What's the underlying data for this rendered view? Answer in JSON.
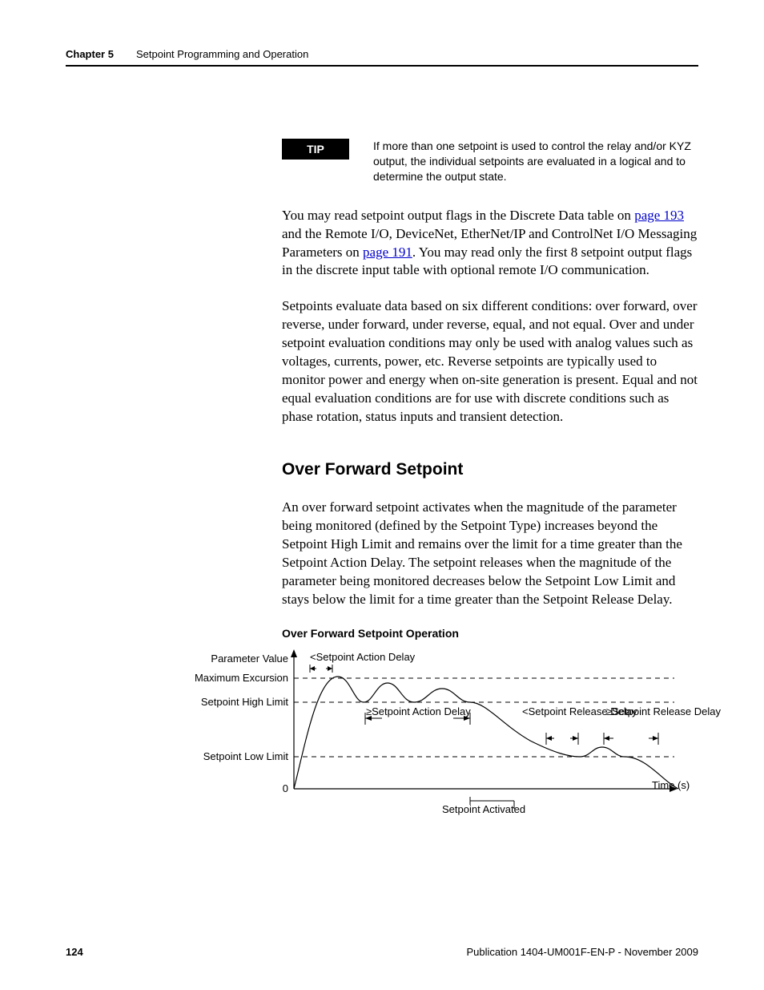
{
  "header": {
    "chapter_label": "Chapter 5",
    "chapter_title": "Setpoint Programming and Operation"
  },
  "tip": {
    "badge": "TIP",
    "text": "If more than one setpoint is used to control the relay and/or KYZ output, the individual setpoints are evaluated in a logical and to determine the output state."
  },
  "para1_a": "You may read setpoint output flags in the Discrete Data table on ",
  "para1_link1": "page 193",
  "para1_b": " and the Remote I/O, DeviceNet, EtherNet/IP and ControlNet I/O Messaging Parameters on ",
  "para1_link2": "page 191",
  "para1_c": ". You may read only the first 8 setpoint output flags in the discrete input table with optional remote I/O communication.",
  "para2": "Setpoints evaluate data based on six different conditions: over forward, over reverse, under forward, under reverse, equal, and not equal. Over and under setpoint evaluation conditions may only be used with analog values such as voltages, currents, power, etc. Reverse setpoints are typically used to monitor power and energy when on-site generation is present. Equal and not equal evaluation conditions are for use with discrete conditions such as phase rotation, status inputs and transient detection.",
  "subhead": "Over Forward Setpoint",
  "para3": "An over forward setpoint activates when the magnitude of the parameter being monitored (defined by the Setpoint Type) increases beyond the Setpoint High Limit and remains over the limit for a time greater than the Setpoint Action Delay. The setpoint releases when the magnitude of the parameter being monitored decreases below the Setpoint Low Limit and stays below the limit for a time greater than the Setpoint Release Delay.",
  "figure": {
    "title": "Over Forward Setpoint Operation",
    "labels": {
      "param_value": "Parameter Value",
      "max_excursion": "Maximum Excursion",
      "high_limit": "Setpoint High Limit",
      "low_limit": "Setpoint Low Limit",
      "zero": "0",
      "lt_action_delay": "<Setpoint Action Delay",
      "ge_action_delay": "≥Setpoint Action Delay",
      "lt_release_delay": "<Setpoint Release Delay",
      "ge_release_delay": "≥Setpoint Release Delay",
      "time": "Time (s)",
      "activated": "Setpoint Activated"
    }
  },
  "footer": {
    "page": "124",
    "pub": "Publication 1404-UM001F-EN-P - November 2009"
  },
  "chart_data": {
    "type": "line",
    "title": "Over Forward Setpoint Operation",
    "xlabel": "Time (s)",
    "ylabel": "Parameter Value",
    "y_levels": [
      "0",
      "Setpoint Low Limit",
      "Setpoint High Limit",
      "Maximum Excursion"
    ],
    "annotations": [
      "<Setpoint Action Delay",
      "≥Setpoint Action Delay",
      "<Setpoint Release Delay",
      "≥Setpoint Release Delay",
      "Setpoint Activated"
    ],
    "curve_description": "Damped oscillation rising from 0, peaking at Maximum Excursion, oscillating across Setpoint High Limit, then decaying below Setpoint Low Limit toward 0",
    "x": [
      0.0,
      0.05,
      0.1,
      0.15,
      0.18,
      0.22,
      0.26,
      0.3,
      0.35,
      0.4,
      0.45,
      0.5,
      0.55,
      0.6,
      0.65,
      0.7,
      0.75,
      0.8,
      0.85,
      0.88,
      0.92,
      0.96,
      1.0
    ],
    "y": [
      0.0,
      0.45,
      0.85,
      1.0,
      0.9,
      0.72,
      0.86,
      0.94,
      0.84,
      0.74,
      0.8,
      0.85,
      0.78,
      0.7,
      0.62,
      0.54,
      0.46,
      0.38,
      0.3,
      0.26,
      0.3,
      0.22,
      0.05
    ],
    "y_norm_note": "y normalized 0..1 where 1.00 = Maximum Excursion, ~0.80 = Setpoint High Limit, ~0.30 = Setpoint Low Limit"
  }
}
